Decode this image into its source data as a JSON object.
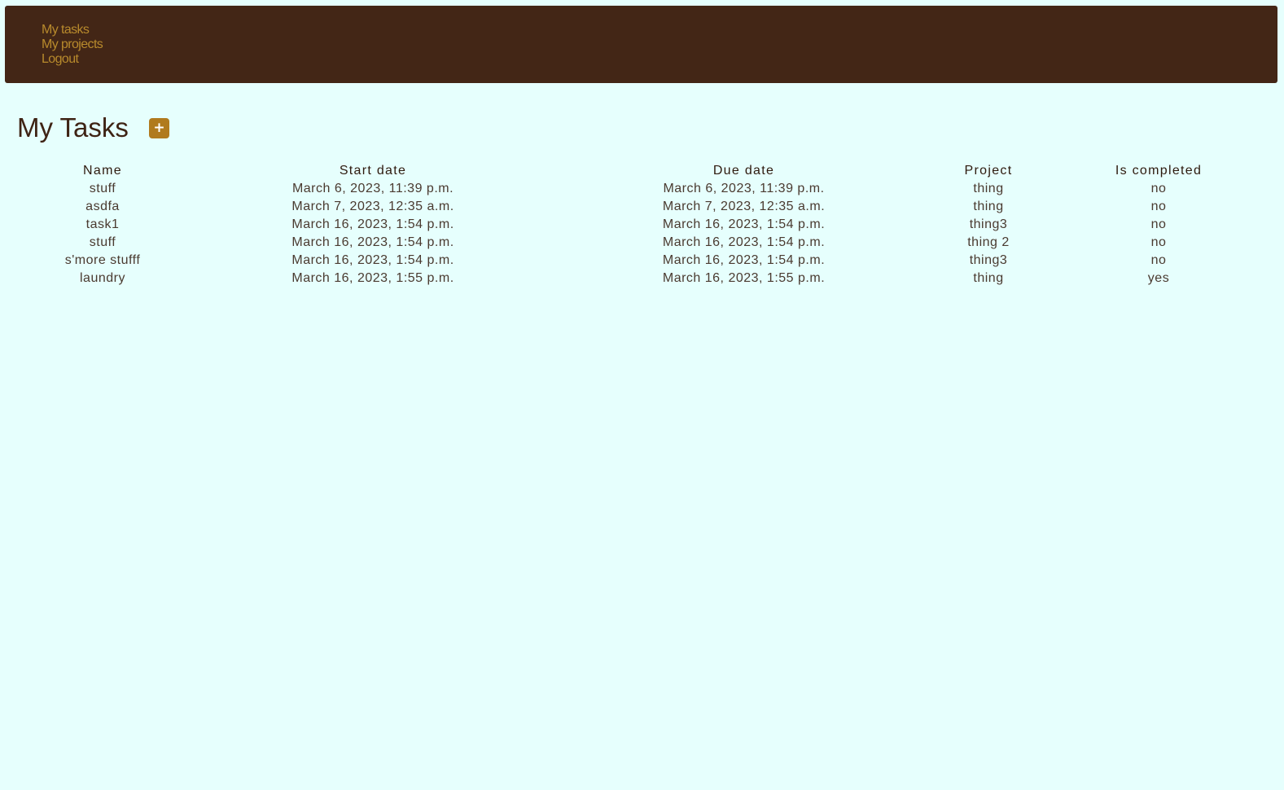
{
  "nav": {
    "items": [
      {
        "label": "My tasks"
      },
      {
        "label": "My projects"
      },
      {
        "label": "Logout"
      }
    ]
  },
  "page": {
    "title": "My Tasks",
    "add_button_label": "+"
  },
  "table": {
    "headers": [
      "Name",
      "Start date",
      "Due date",
      "Project",
      "Is completed"
    ],
    "rows": [
      [
        "stuff",
        "March 6, 2023, 11:39 p.m.",
        "March 6, 2023, 11:39 p.m.",
        "thing",
        "no"
      ],
      [
        "asdfa",
        "March 7, 2023, 12:35 a.m.",
        "March 7, 2023, 12:35 a.m.",
        "thing",
        "no"
      ],
      [
        "task1",
        "March 16, 2023, 1:54 p.m.",
        "March 16, 2023, 1:54 p.m.",
        "thing3",
        "no"
      ],
      [
        "stuff",
        "March 16, 2023, 1:54 p.m.",
        "March 16, 2023, 1:54 p.m.",
        "thing 2",
        "no"
      ],
      [
        "s'more stufff",
        "March 16, 2023, 1:54 p.m.",
        "March 16, 2023, 1:54 p.m.",
        "thing3",
        "no"
      ],
      [
        "laundry",
        "March 16, 2023, 1:55 p.m.",
        "March 16, 2023, 1:55 p.m.",
        "thing",
        "yes"
      ]
    ]
  },
  "colors": {
    "background": "#e6fffd",
    "navbar": "#432616",
    "nav_link": "#b88a2c",
    "accent_button": "#b07a1e",
    "text_dark": "#3e2314"
  }
}
